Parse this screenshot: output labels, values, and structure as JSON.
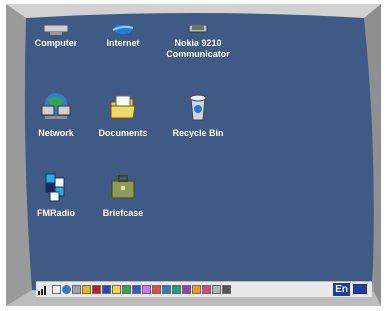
{
  "desktop": {
    "background": "#3f5a84",
    "icons": [
      {
        "label": "Computer",
        "icon": "computer-icon"
      },
      {
        "label": "Internet",
        "icon": "internet-explorer-icon"
      },
      {
        "label": "Nokia 9210\nCommunicator",
        "icon": "nokia-communicator-icon"
      },
      {
        "label": "Network",
        "icon": "network-icon"
      },
      {
        "label": "Documents",
        "icon": "documents-folder-icon"
      },
      {
        "label": "Recycle Bin",
        "icon": "recycle-bin-icon"
      },
      {
        "label": "FMRadio",
        "icon": "fm-radio-icon"
      },
      {
        "label": "Briefcase",
        "icon": "briefcase-icon"
      }
    ]
  },
  "taskbar": {
    "language": "En",
    "tray_icons": [
      "signal-icon",
      "app-icon",
      "globe-icon",
      "app-icon",
      "arrow-icon",
      "app-icon",
      "app-icon",
      "app-icon",
      "app-icon",
      "app-icon",
      "app-icon",
      "app-icon",
      "app-icon",
      "app-icon",
      "app-icon",
      "app-icon",
      "app-icon",
      "app-icon",
      "app-icon"
    ]
  },
  "colors": {
    "bezel": "#a9a9a9",
    "desktop": "#3f5a84",
    "taskbar": "#e9e9e9"
  }
}
